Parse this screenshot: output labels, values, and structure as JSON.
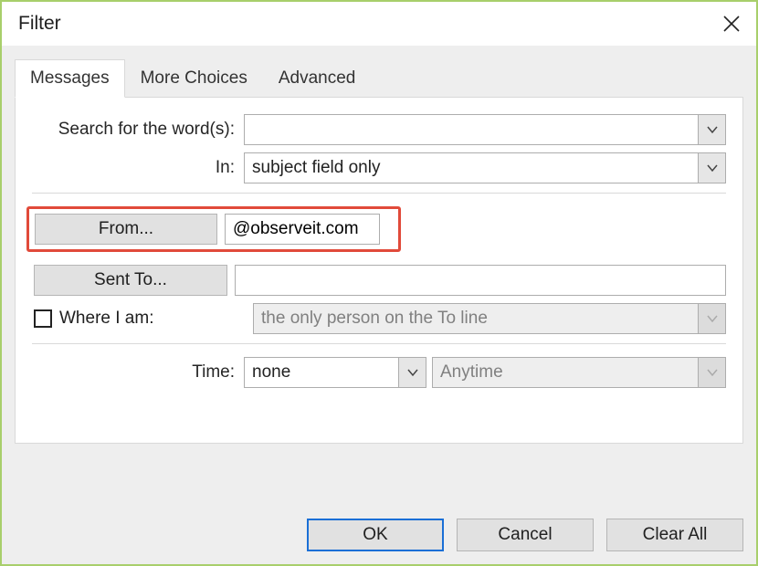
{
  "window": {
    "title": "Filter"
  },
  "tabs": {
    "messages": "Messages",
    "more_choices": "More Choices",
    "advanced": "Advanced"
  },
  "labels": {
    "search_for": "Search for the word(s):",
    "in": "In:",
    "where_i_am": "Where I am:",
    "time": "Time:"
  },
  "buttons": {
    "from": "From...",
    "sent_to": "Sent To...",
    "ok": "OK",
    "cancel": "Cancel",
    "clear_all": "Clear All"
  },
  "fields": {
    "search_value": "",
    "in_value": "subject field only",
    "from_value": "@observeit.com",
    "sent_to_value": "",
    "where_value": "the only person on the To line",
    "time_value": "none",
    "time_range_value": "Anytime"
  }
}
